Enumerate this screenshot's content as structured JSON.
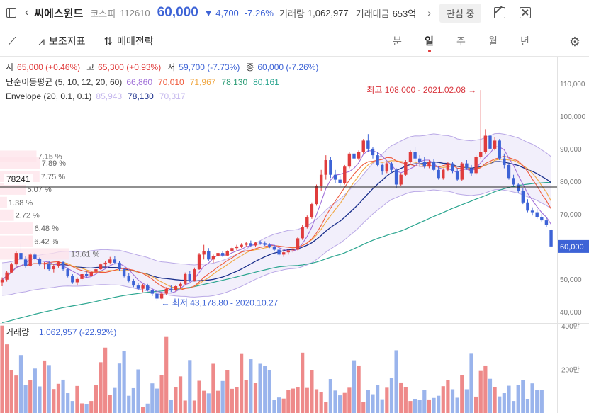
{
  "header": {
    "name": "씨에스윈드",
    "market": "코스피",
    "code": "112610",
    "price": "60,000",
    "change": "▼ 4,700",
    "change_pct": "-7.26%",
    "volume_label": "거래량",
    "volume": "1,062,977",
    "amount_label": "거래대금",
    "amount": "653억",
    "more": "›",
    "favorite": "관심 중"
  },
  "toolbar": {
    "draw": "",
    "indicators": "보조지표",
    "strategy": "매매전략",
    "periods": [
      "분",
      "일",
      "주",
      "월",
      "년"
    ],
    "active_period": "일"
  },
  "chart_data": {
    "type": "candlestick",
    "ohlc": {
      "open_label": "시",
      "open": "65,000 (+0.46%)",
      "high_label": "고",
      "high": "65,300 (+0.93%)",
      "low_label": "저",
      "low": "59,700 (-7.73%)",
      "close_label": "종",
      "close": "60,000 (-7.26%)"
    },
    "ma": {
      "label": "단순이동평균 (5, 10, 12, 20, 60)",
      "values": [
        "66,860",
        "70,010",
        "71,967",
        "78,130",
        "80,161"
      ]
    },
    "envelope": {
      "label": "Envelope (20, 0.1, 0.1)",
      "values": [
        "85,943",
        "78,130",
        "70,317"
      ]
    },
    "y_ticks": [
      110000,
      100000,
      90000,
      80000,
      70000,
      60000,
      50000,
      40000
    ],
    "y_tick_labels": [
      "110,000",
      "100,000",
      "90,000",
      "80,000",
      "70,000",
      "60,000",
      "50,000",
      "40,000"
    ],
    "ylim": [
      36500,
      116500
    ],
    "current_price": 60000,
    "current_label": "60,000",
    "crosshair_value": 78241,
    "crosshair_label": "78241",
    "annotation_high": "최고 108,000 - 2021.02.08 →",
    "annotation_low": "← 최저 43,178.80 - 2020.10.27",
    "volume_profile": [
      {
        "price": 87700,
        "pct": "7.15 %",
        "share": 7.15
      },
      {
        "price": 85600,
        "pct": "7.89 %",
        "share": 7.89
      },
      {
        "price": 81500,
        "pct": "7.75 %",
        "share": 7.75
      },
      {
        "price": 77600,
        "pct": "5.07 %",
        "share": 5.07
      },
      {
        "price": 73500,
        "pct": "1.38 %",
        "share": 1.38
      },
      {
        "price": 69600,
        "pct": "2.72 %",
        "share": 2.72
      },
      {
        "price": 65600,
        "pct": "6.48 %",
        "share": 6.48
      },
      {
        "price": 61600,
        "pct": "6.42 %",
        "share": 6.42
      },
      {
        "price": 57700,
        "pct": "13.61 %",
        "share": 13.61
      }
    ],
    "volume_label": "거래량",
    "volume_value": "1,062,957 (-22.92%)",
    "volume_ticks": [
      "400만",
      "200만"
    ],
    "volume_ylim": [
      0,
      4000000
    ],
    "series_colors": {
      "up": "#e03c3c",
      "down": "#3d63d6",
      "ma5": "#a070d8",
      "ma10": "#ef5a3c",
      "ma12": "#f0a640",
      "ma20": "#1a2f8c",
      "ma60": "#2aa58f",
      "env": "#b9a8e6",
      "env_fill": "#f1edfb"
    },
    "candles": [
      [
        49000,
        50500,
        47800,
        49800
      ],
      [
        49800,
        52500,
        49200,
        52000
      ],
      [
        52000,
        55000,
        51800,
        54500
      ],
      [
        54500,
        58500,
        54000,
        58000
      ],
      [
        58000,
        61000,
        55500,
        56000
      ],
      [
        56000,
        57000,
        53500,
        54000
      ],
      [
        54000,
        58000,
        53800,
        57500
      ],
      [
        57500,
        58000,
        55800,
        56200
      ],
      [
        56200,
        56600,
        54000,
        54500
      ],
      [
        54500,
        55200,
        53000,
        54800
      ],
      [
        54800,
        55500,
        52500,
        53000
      ],
      [
        53000,
        54500,
        52000,
        54000
      ],
      [
        54000,
        55600,
        53500,
        55200
      ],
      [
        55200,
        55500,
        52500,
        53000
      ],
      [
        53000,
        53500,
        50500,
        51000
      ],
      [
        51000,
        51500,
        48500,
        49000
      ],
      [
        49000,
        50500,
        48000,
        50000
      ],
      [
        50000,
        52000,
        49500,
        51500
      ],
      [
        51500,
        52500,
        50500,
        51000
      ],
      [
        51000,
        52500,
        50800,
        52200
      ],
      [
        52200,
        53500,
        52000,
        53000
      ],
      [
        53000,
        54800,
        52800,
        54500
      ],
      [
        54500,
        55500,
        53800,
        55000
      ],
      [
        55000,
        56800,
        54500,
        56000
      ],
      [
        56000,
        57000,
        54500,
        55000
      ],
      [
        55000,
        55500,
        52500,
        53000
      ],
      [
        53000,
        53500,
        50500,
        51000
      ],
      [
        51000,
        51800,
        49000,
        49500
      ],
      [
        49500,
        50000,
        47500,
        48000
      ],
      [
        48000,
        48800,
        46500,
        47000
      ],
      [
        47000,
        48500,
        46000,
        48000
      ],
      [
        48000,
        48500,
        46200,
        46500
      ],
      [
        46500,
        47000,
        44800,
        45500
      ],
      [
        45500,
        46500,
        43200,
        44000
      ],
      [
        44000,
        46000,
        43800,
        45500
      ],
      [
        45500,
        47500,
        45000,
        47000
      ],
      [
        47000,
        48200,
        46000,
        46500
      ],
      [
        46500,
        48000,
        46200,
        47800
      ],
      [
        47800,
        49000,
        47000,
        48500
      ],
      [
        48500,
        52000,
        48000,
        51500
      ],
      [
        51500,
        52500,
        49000,
        49500
      ],
      [
        49500,
        53500,
        49200,
        53000
      ],
      [
        53000,
        58000,
        52800,
        57500
      ],
      [
        57500,
        60500,
        56000,
        58500
      ],
      [
        58500,
        59500,
        55500,
        56000
      ],
      [
        56000,
        57500,
        55000,
        57000
      ],
      [
        57000,
        58500,
        56500,
        58000
      ],
      [
        58000,
        58500,
        56800,
        57200
      ],
      [
        57200,
        58800,
        57000,
        58500
      ],
      [
        58500,
        60000,
        58000,
        59500
      ],
      [
        59500,
        60500,
        58800,
        60000
      ],
      [
        60000,
        61000,
        59500,
        60500
      ],
      [
        60500,
        61500,
        60000,
        61000
      ],
      [
        61000,
        61800,
        60000,
        60300
      ],
      [
        60300,
        61500,
        60000,
        61200
      ],
      [
        61200,
        61800,
        60500,
        61000
      ],
      [
        61000,
        61600,
        60200,
        60500
      ],
      [
        60500,
        61000,
        59500,
        60000
      ],
      [
        60000,
        60500,
        58500,
        59000
      ],
      [
        59000,
        59500,
        57000,
        57500
      ],
      [
        57500,
        58500,
        56800,
        58200
      ],
      [
        58200,
        59200,
        57500,
        58800
      ],
      [
        58800,
        59500,
        58000,
        59000
      ],
      [
        59000,
        63000,
        58800,
        62500
      ],
      [
        62500,
        66500,
        62000,
        66000
      ],
      [
        66000,
        69500,
        65500,
        69000
      ],
      [
        69000,
        73500,
        68500,
        73000
      ],
      [
        73000,
        79000,
        72500,
        78500
      ],
      [
        78500,
        83500,
        77000,
        82000
      ],
      [
        82000,
        88000,
        80500,
        86500
      ],
      [
        86500,
        87500,
        81000,
        82000
      ],
      [
        82000,
        83500,
        79500,
        80500
      ],
      [
        80500,
        81500,
        78500,
        79500
      ],
      [
        79500,
        85000,
        79000,
        84500
      ],
      [
        84500,
        89000,
        84000,
        88500
      ],
      [
        88500,
        90500,
        86500,
        87000
      ],
      [
        87000,
        89500,
        86500,
        89000
      ],
      [
        89000,
        93000,
        88500,
        92500
      ],
      [
        92500,
        94500,
        89000,
        90000
      ],
      [
        90000,
        90500,
        87000,
        88000
      ],
      [
        88000,
        89000,
        84500,
        85000
      ],
      [
        85000,
        85500,
        82000,
        83000
      ],
      [
        83000,
        86000,
        82500,
        85500
      ],
      [
        85500,
        86000,
        82500,
        83500
      ],
      [
        83500,
        84000,
        78000,
        79000
      ],
      [
        79000,
        82500,
        78500,
        82000
      ],
      [
        82000,
        86500,
        81500,
        86000
      ],
      [
        86000,
        89500,
        85500,
        89000
      ],
      [
        89000,
        90500,
        86000,
        87000
      ],
      [
        87000,
        88000,
        84500,
        86000
      ],
      [
        86000,
        87500,
        84000,
        84500
      ],
      [
        84500,
        86500,
        84000,
        86000
      ],
      [
        86000,
        86800,
        83000,
        83500
      ],
      [
        83500,
        84500,
        80500,
        81000
      ],
      [
        81000,
        84000,
        80500,
        83500
      ],
      [
        83500,
        86000,
        83000,
        85500
      ],
      [
        85500,
        86000,
        82500,
        83000
      ],
      [
        83000,
        84000,
        80000,
        80500
      ],
      [
        80500,
        86000,
        80000,
        85500
      ],
      [
        85500,
        86500,
        83500,
        84000
      ],
      [
        84000,
        85000,
        81500,
        82500
      ],
      [
        82500,
        88000,
        82000,
        87500
      ],
      [
        87500,
        108000,
        87000,
        89000
      ],
      [
        89000,
        96000,
        88500,
        94000
      ],
      [
        94000,
        95000,
        89000,
        90000
      ],
      [
        90000,
        93500,
        89500,
        92500
      ],
      [
        92500,
        93000,
        86500,
        87000
      ],
      [
        87000,
        88500,
        84000,
        85000
      ],
      [
        85000,
        85500,
        80500,
        81000
      ],
      [
        81000,
        82000,
        78500,
        79000
      ],
      [
        79000,
        79500,
        76500,
        77000
      ],
      [
        77000,
        77800,
        73000,
        73500
      ],
      [
        73500,
        74500,
        70500,
        71000
      ],
      [
        71000,
        72000,
        69500,
        70500
      ],
      [
        70500,
        71500,
        68500,
        69000
      ],
      [
        69000,
        70000,
        67500,
        68000
      ],
      [
        68000,
        68800,
        66000,
        66500
      ],
      [
        65000,
        65300,
        59700,
        60000
      ]
    ],
    "volumes": [
      4010000,
      3150000,
      1960000,
      1720000,
      2660000,
      1300000,
      1520000,
      2040000,
      1220000,
      2410000,
      2200000,
      1100000,
      1340000,
      1530000,
      910000,
      550000,
      1240000,
      440000,
      420000,
      550000,
      1300000,
      2330000,
      3000000,
      840000,
      1150000,
      2270000,
      2840000,
      790000,
      1140000,
      2000000,
      290000,
      430000,
      1360000,
      1120000,
      1750000,
      3490000,
      610000,
      1200000,
      1680000,
      570000,
      2430000,
      570000,
      1480000,
      1020000,
      900000,
      2260000,
      1020000,
      1470000,
      1960000,
      1110000,
      1190000,
      2710000,
      1520000,
      2470000,
      1380000,
      2260000,
      2170000,
      1960000,
      590000,
      710000,
      660000,
      1050000,
      1120000,
      1170000,
      2770000,
      1150000,
      1960000,
      1090000,
      960000,
      490000,
      1560000,
      1030000,
      810000,
      920000,
      1160000,
      2420000,
      2180000,
      490000,
      1050000,
      860000,
      1290000,
      630000,
      1160000,
      1600000,
      2880000,
      1400000,
      1190000,
      550000,
      650000,
      610000,
      1050000,
      620000,
      690000,
      790000,
      1230000,
      1520000,
      1090000,
      700000,
      1740000,
      1090000,
      2720000,
      750000,
      1930000,
      2180000,
      1570000,
      1200000,
      760000,
      910000,
      1250000,
      550000,
      1280000,
      1520000,
      650000,
      1360000,
      1040000,
      1060000
    ]
  }
}
